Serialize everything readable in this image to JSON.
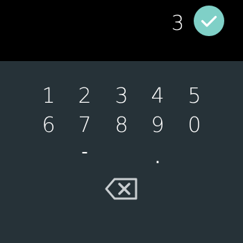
{
  "header": {
    "entry_value": "3",
    "confirm_icon": "checkmark-icon",
    "confirm_color": "#7fd0c7"
  },
  "keypad": {
    "background": "#263238",
    "row1": [
      "1",
      "2",
      "3",
      "4",
      "5"
    ],
    "row2": [
      "6",
      "7",
      "8",
      "9",
      "0"
    ],
    "minus_label": "-",
    "decimal_label": ".",
    "backspace_icon": "backspace-icon"
  }
}
